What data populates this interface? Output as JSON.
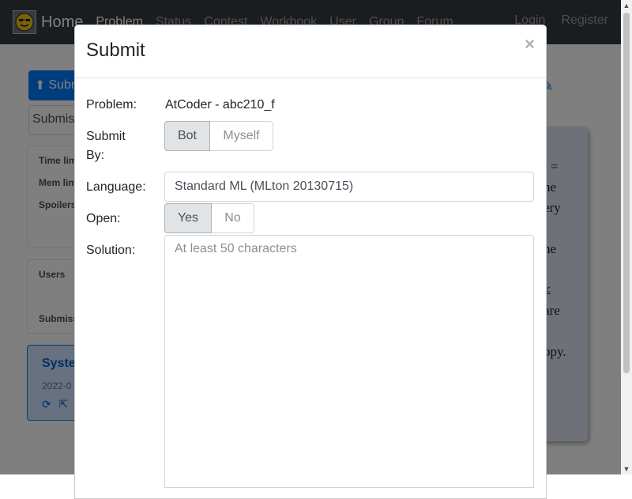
{
  "navbar": {
    "brand": "Home",
    "links": [
      "Problem",
      "Status",
      "Contest",
      "Workbook",
      "User",
      "Group",
      "Forum"
    ],
    "login": "Login",
    "register": "Register"
  },
  "background": {
    "submit_btn": "Subm",
    "submission_input": "Submis",
    "card1": [
      "Time limit",
      "Mem limit",
      "Spoilers"
    ],
    "card2": [
      "Users",
      "Submiss"
    ],
    "system_title": "Syste",
    "system_date": "2022-0",
    "paper_lines": [
      "i =",
      "he",
      "ery",
      "",
      "he",
      "",
      "≤",
      "are",
      "",
      "ppy."
    ]
  },
  "modal": {
    "title": "Submit",
    "close": "×",
    "problem_label": "Problem:",
    "problem_value": "AtCoder - abc210_f",
    "submit_by_label": "Submit By:",
    "submit_by_options": [
      "Bot",
      "Myself"
    ],
    "submit_by_selected": "Bot",
    "language_label": "Language:",
    "language_value": "Standard ML (MLton 20130715)",
    "open_label": "Open:",
    "open_options": [
      "Yes",
      "No"
    ],
    "open_selected": "Yes",
    "solution_label": "Solution:",
    "solution_placeholder": "At least 50 characters"
  },
  "colors": {
    "navbar": "#343a40",
    "primary": "#007bff",
    "selected_toggle": "#e2e3e5"
  }
}
